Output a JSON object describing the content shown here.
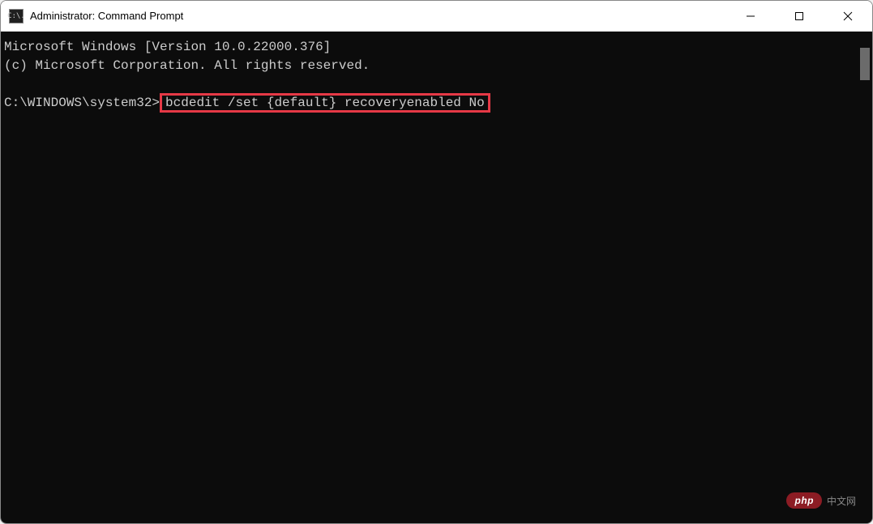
{
  "window": {
    "title": "Administrator: Command Prompt",
    "app_icon_text": "C:\\."
  },
  "terminal": {
    "line1": "Microsoft Windows [Version 10.0.22000.376]",
    "line2": "(c) Microsoft Corporation. All rights reserved.",
    "prompt": "C:\\WINDOWS\\system32>",
    "command": "bcdedit /set {default} recoveryenabled No"
  },
  "watermark": {
    "badge": "php",
    "text": "中文网"
  }
}
